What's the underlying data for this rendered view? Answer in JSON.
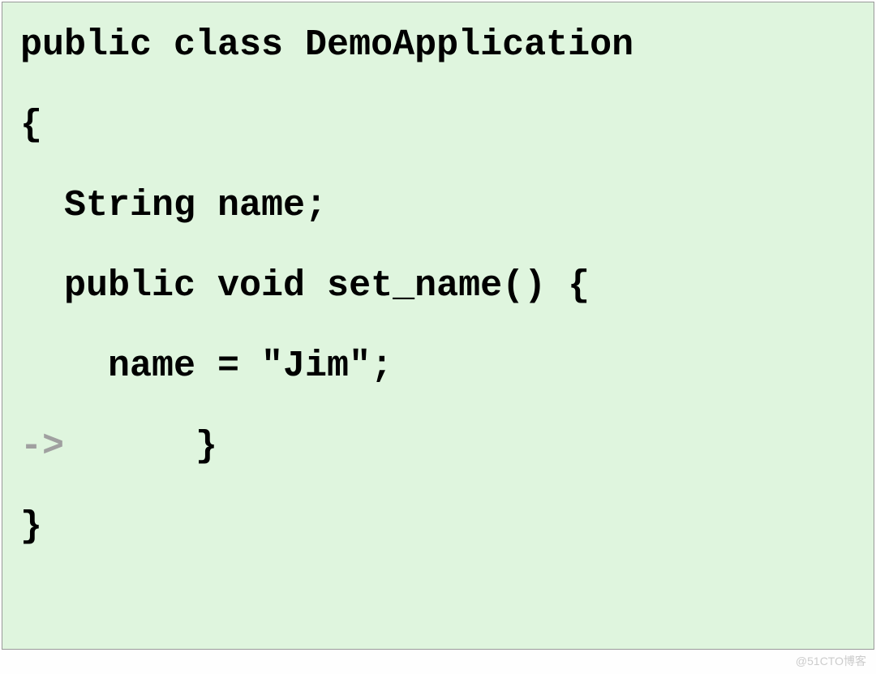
{
  "code": {
    "lines": [
      {
        "gutter": "",
        "text": "public class DemoApplication"
      },
      {
        "gutter": "",
        "text": "{"
      },
      {
        "gutter": "",
        "text": "  String name;"
      },
      {
        "gutter": "",
        "text": ""
      },
      {
        "gutter": "",
        "text": "  public void set_name() {"
      },
      {
        "gutter": "",
        "text": "    name = \"Jim\";"
      },
      {
        "gutter": "->",
        "text": "      }"
      },
      {
        "gutter": "",
        "text": "}"
      }
    ]
  },
  "watermark": "@51CTO博客"
}
